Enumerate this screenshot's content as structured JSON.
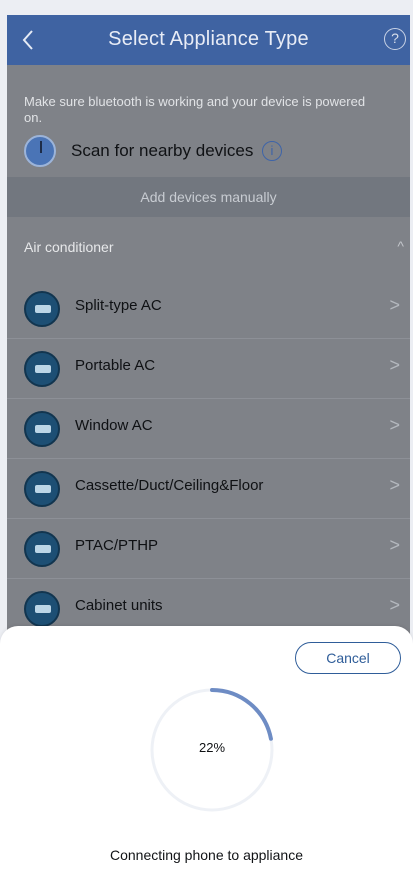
{
  "header": {
    "title": "Select Appliance Type",
    "back_icon": "chevron-left-icon",
    "help_icon": "question-circle-icon",
    "help_glyph": "?"
  },
  "colors": {
    "header_bg": "#3f63a2",
    "accent": "#2f5d99",
    "progress_arc": "#6e8cc4",
    "progress_track": "#eef1f6"
  },
  "hint": "Make sure bluetooth is working and your device is powered on.",
  "scan": {
    "label": "Scan for nearby devices",
    "info_glyph": "i"
  },
  "manual_label": "Add devices manually",
  "section": {
    "label": "Air conditioner",
    "chevron": "^"
  },
  "appliances": [
    {
      "name": "Split-type AC",
      "arrow": ">"
    },
    {
      "name": "Portable AC",
      "arrow": ">"
    },
    {
      "name": "Window AC",
      "arrow": ">"
    },
    {
      "name": "Cassette/Duct/Ceiling&Floor",
      "arrow": ">"
    },
    {
      "name": "PTAC/PTHP",
      "arrow": ">"
    },
    {
      "name": "Cabinet units",
      "arrow": ">"
    }
  ],
  "sheet": {
    "cancel_label": "Cancel",
    "progress_percent": 22,
    "progress_label": "22%",
    "status": "Connecting phone to appliance"
  }
}
